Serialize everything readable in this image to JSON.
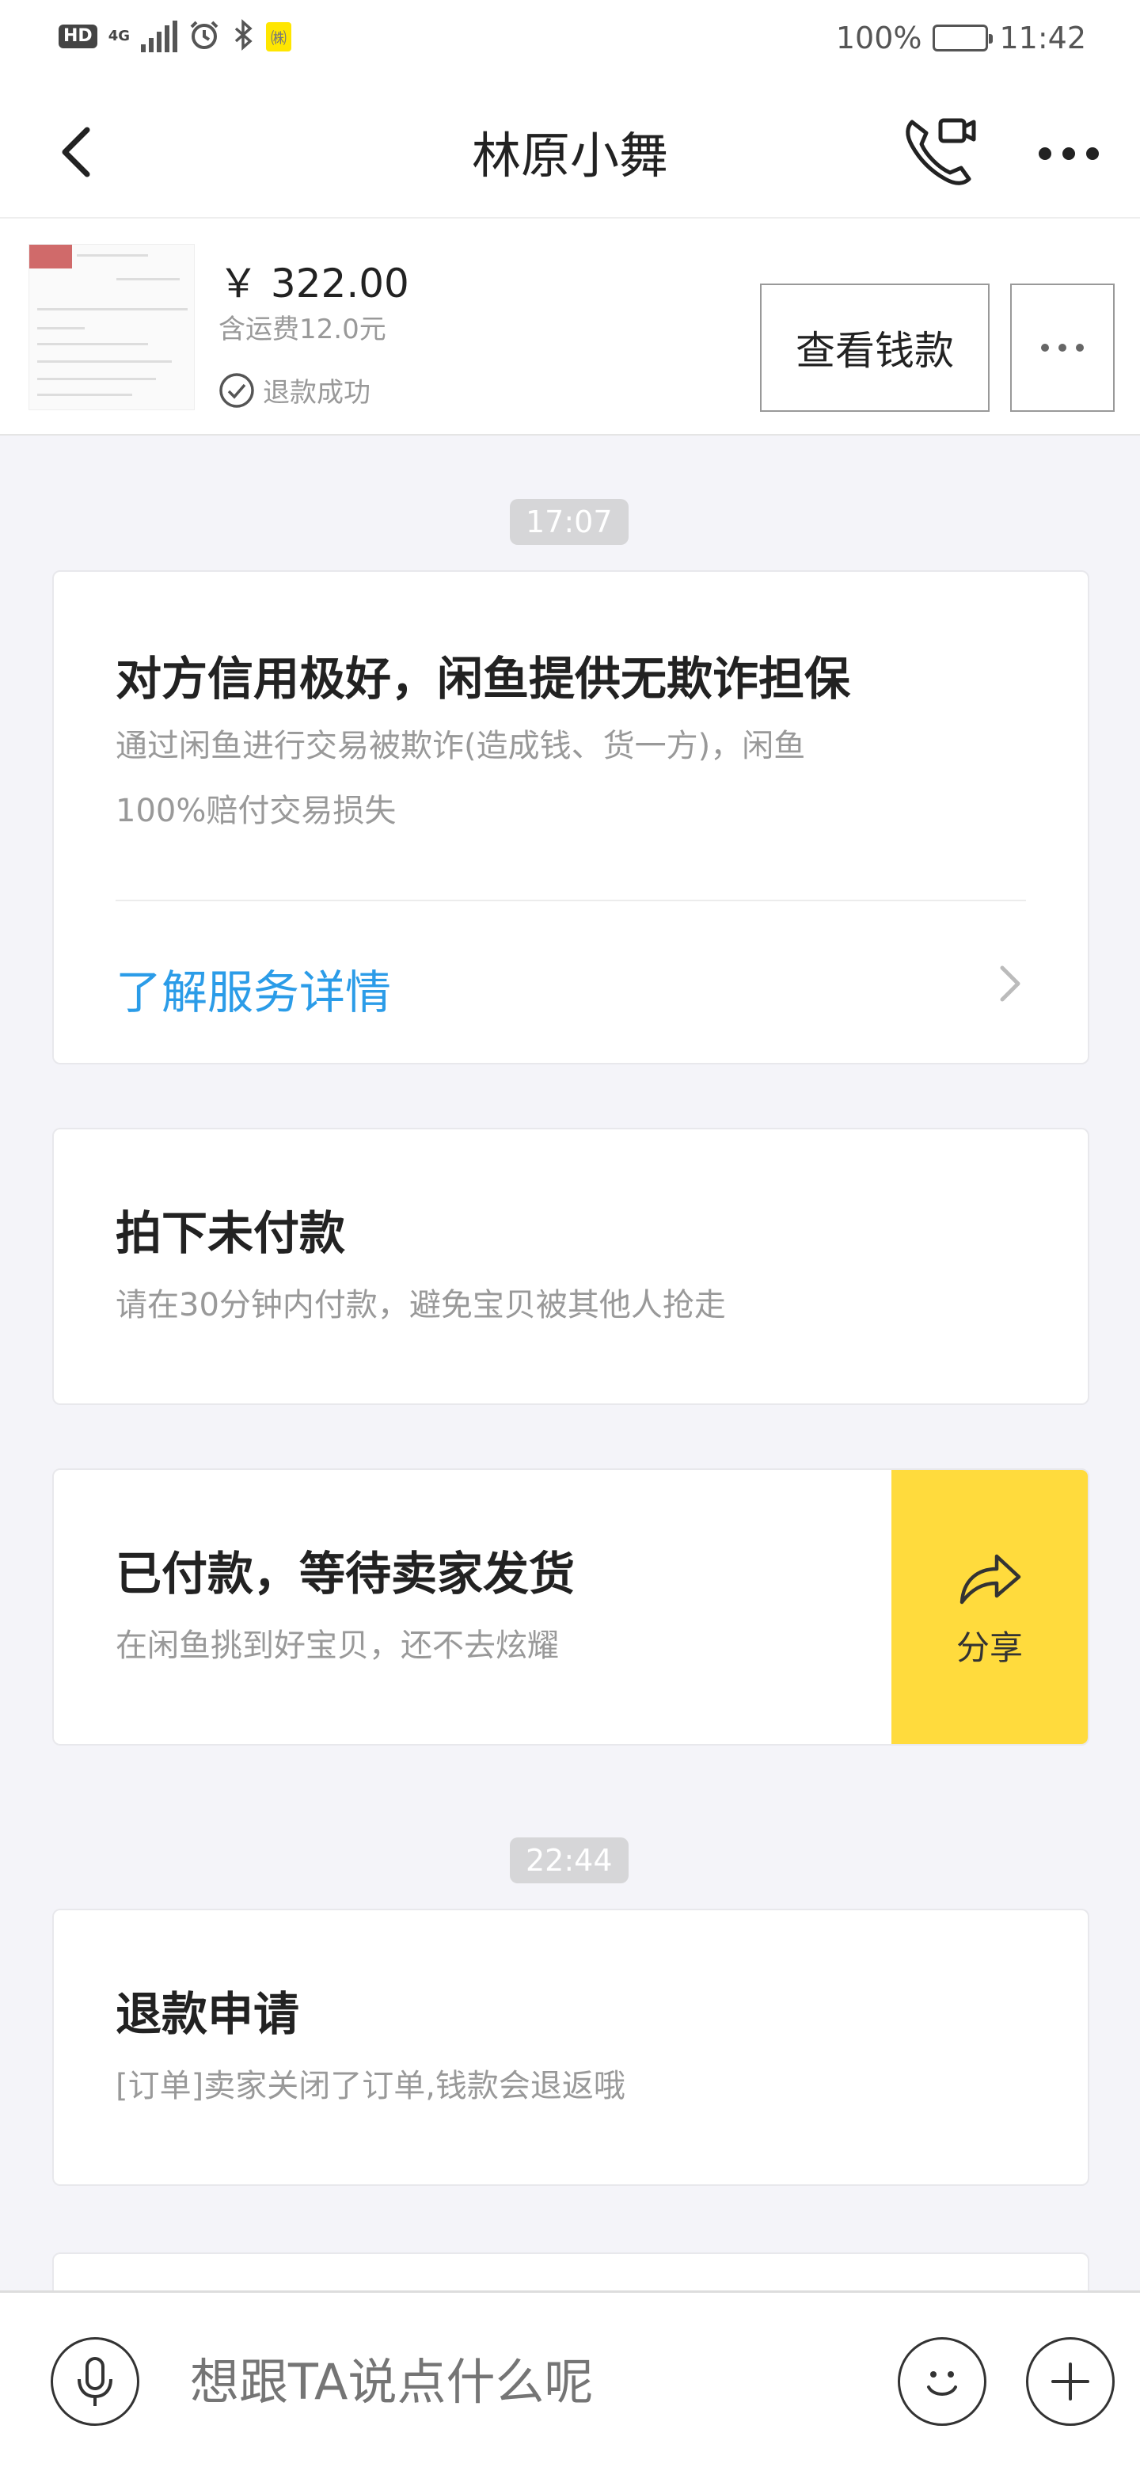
{
  "status_bar": {
    "network_badge": "HD",
    "network_type": "4G",
    "extra_badge": "㈱",
    "battery": "100%",
    "time": "11:42",
    "icons": [
      "signal-icon",
      "alarm-icon",
      "bluetooth-icon",
      "battery-icon"
    ]
  },
  "nav": {
    "title": "林原小舞",
    "icons": [
      "back-icon",
      "video-call-icon",
      "more-icon"
    ]
  },
  "item": {
    "price": "￥ 322.00",
    "shipping": "含运费12.0元",
    "status": "退款成功",
    "view_money_label": "查看钱款"
  },
  "messages": {
    "time1": "17:07",
    "guarantee": {
      "title": "对方信用极好，闲鱼提供无欺诈担保",
      "desc_line1": "通过闲鱼进行交易被欺诈(造成钱、货一方)，闲鱼",
      "desc_line2": "100%赔付交易损失",
      "link": "了解服务详情"
    },
    "unpaid": {
      "title": "拍下未付款",
      "desc": "请在30分钟内付款，避免宝贝被其他人抢走"
    },
    "paid": {
      "title": "已付款，等待卖家发货",
      "desc": "在闲鱼挑到好宝贝，还不去炫耀",
      "share_label": "分享"
    },
    "time2": "22:44",
    "refund": {
      "title": "退款申请",
      "desc": "[订单]卖家关闭了订单,钱款会退返哦"
    }
  },
  "input": {
    "placeholder": "想跟TA说点什么呢",
    "icons": [
      "mic-icon",
      "emoji-icon",
      "plus-icon"
    ]
  },
  "colors": {
    "accent_yellow": "#ffdb3d",
    "link_blue": "#2b9ce8",
    "background": "#f4f4f9"
  }
}
